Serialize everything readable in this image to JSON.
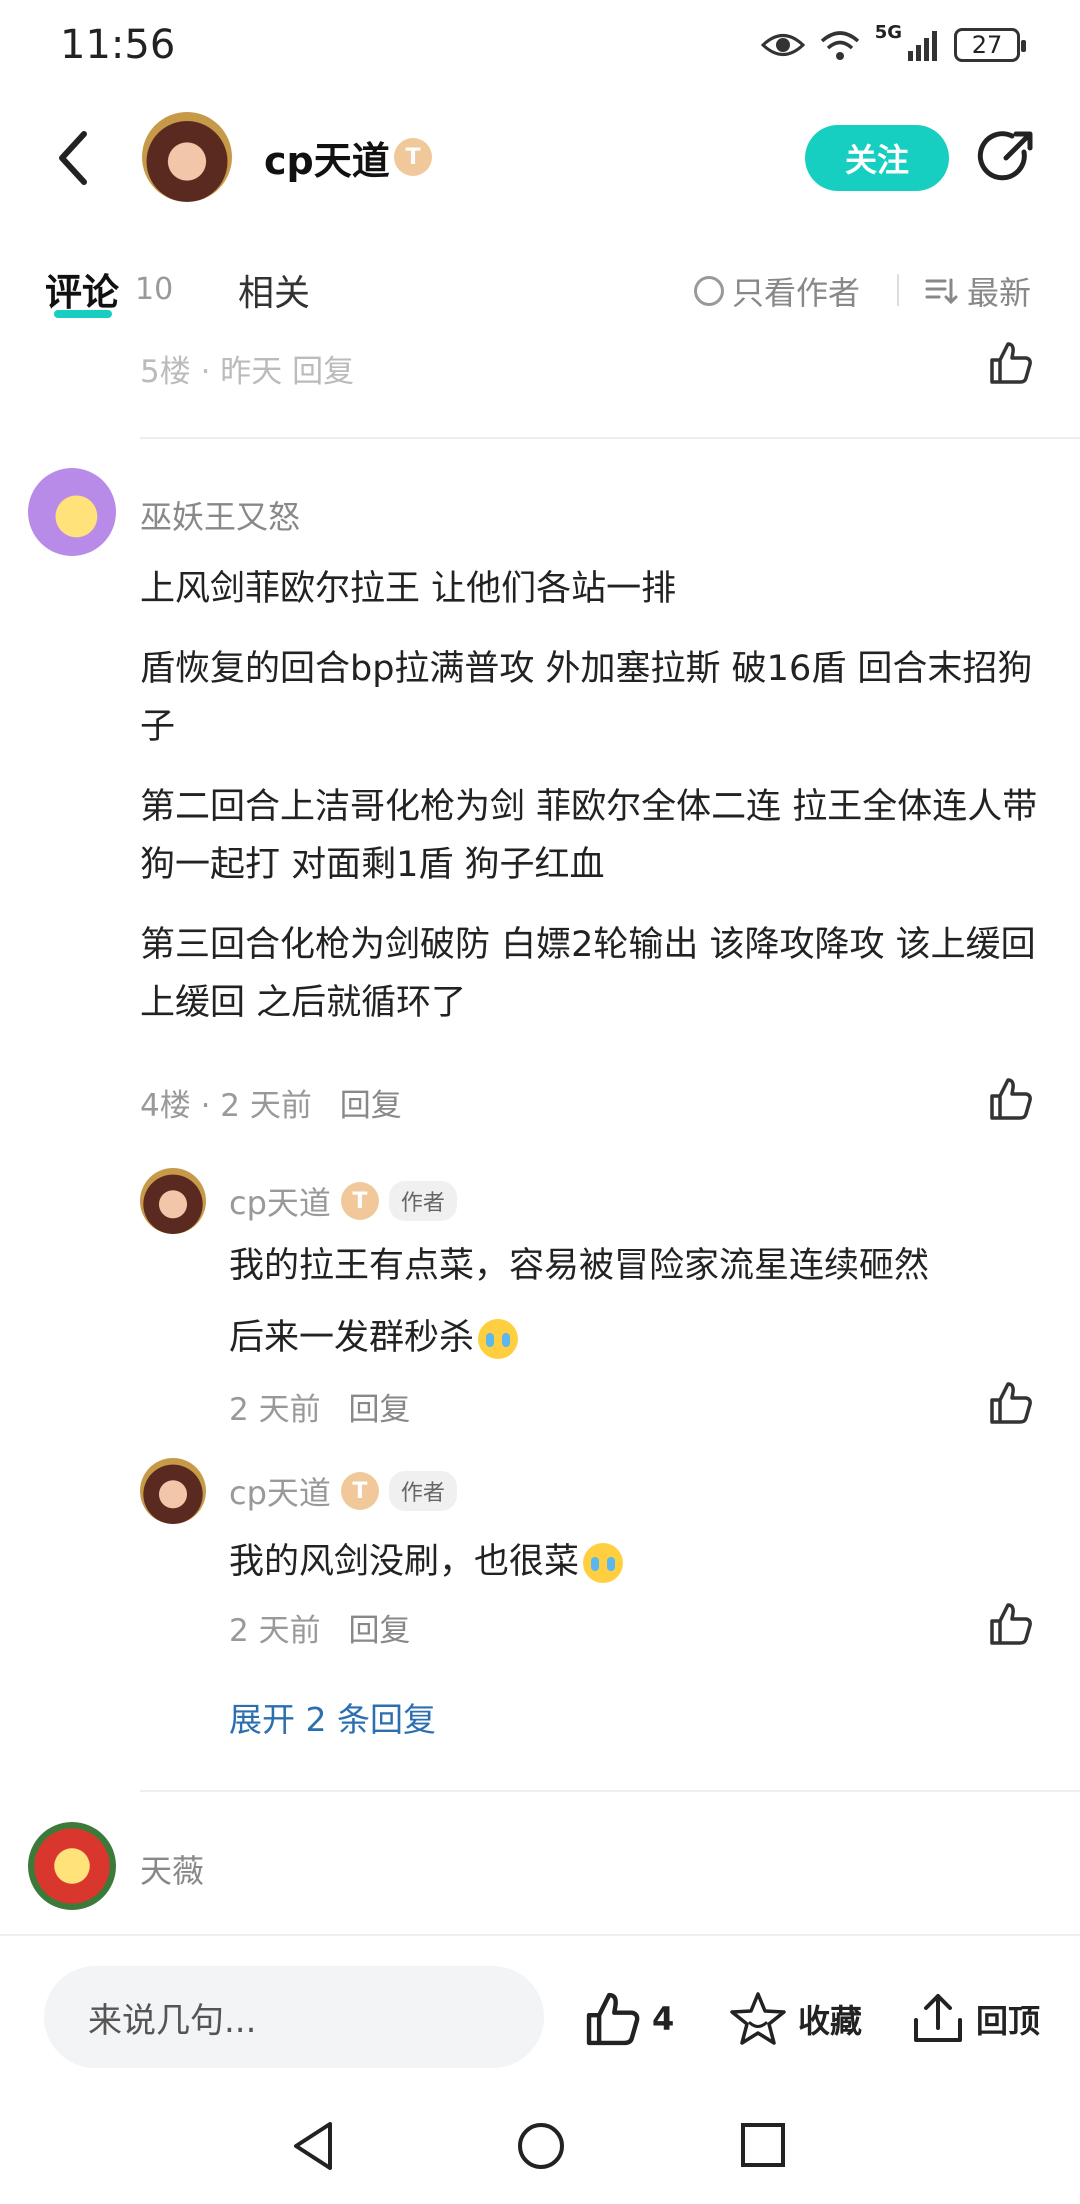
{
  "status_bar": {
    "time": "11:56",
    "network": "5G",
    "battery": "27"
  },
  "header": {
    "author_name": "cp天道",
    "level_badge": "T",
    "follow_label": "关注"
  },
  "tabs": {
    "comments_label": "评论",
    "comments_count": "10",
    "related_label": "相关",
    "author_only_label": "只看作者",
    "sort_label": "最新"
  },
  "floor3": {
    "meta": "5楼 · 昨天  回复"
  },
  "comment4": {
    "username": "巫妖王又怒",
    "paragraphs": [
      "上风剑菲欧尔拉王 让他们各站一排",
      "盾恢复的回合bp拉满普攻 外加塞拉斯 破16盾 回合末招狗子",
      "第二回合上洁哥化枪为剑 菲欧尔全体二连 拉王全体连人带狗一起打 对面剩1盾 狗子红血",
      "第三回合化枪为剑破防 白嫖2轮输出 该降攻降攻 该上缓回上缓回 之后就循环了"
    ],
    "floor": "4楼 · 2 天前",
    "reply_label": "回复"
  },
  "replies": [
    {
      "username": "cp天道",
      "author_tag": "作者",
      "text_line1": "我的拉王有点菜，容易被冒险家流星连续砸然",
      "text_line2": "后来一发群秒杀",
      "time": "2 天前",
      "reply_label": "回复"
    },
    {
      "username": "cp天道",
      "author_tag": "作者",
      "text_line1": "我的风剑没刷，也很菜",
      "time": "2 天前",
      "reply_label": "回复"
    }
  ],
  "expand_replies_label": "展开 2 条回复",
  "comment5": {
    "username": "天薇"
  },
  "bottom_bar": {
    "input_placeholder": "来说几句...",
    "like_count": "4",
    "favorite_label": "收藏",
    "back_to_top_label": "回顶"
  }
}
